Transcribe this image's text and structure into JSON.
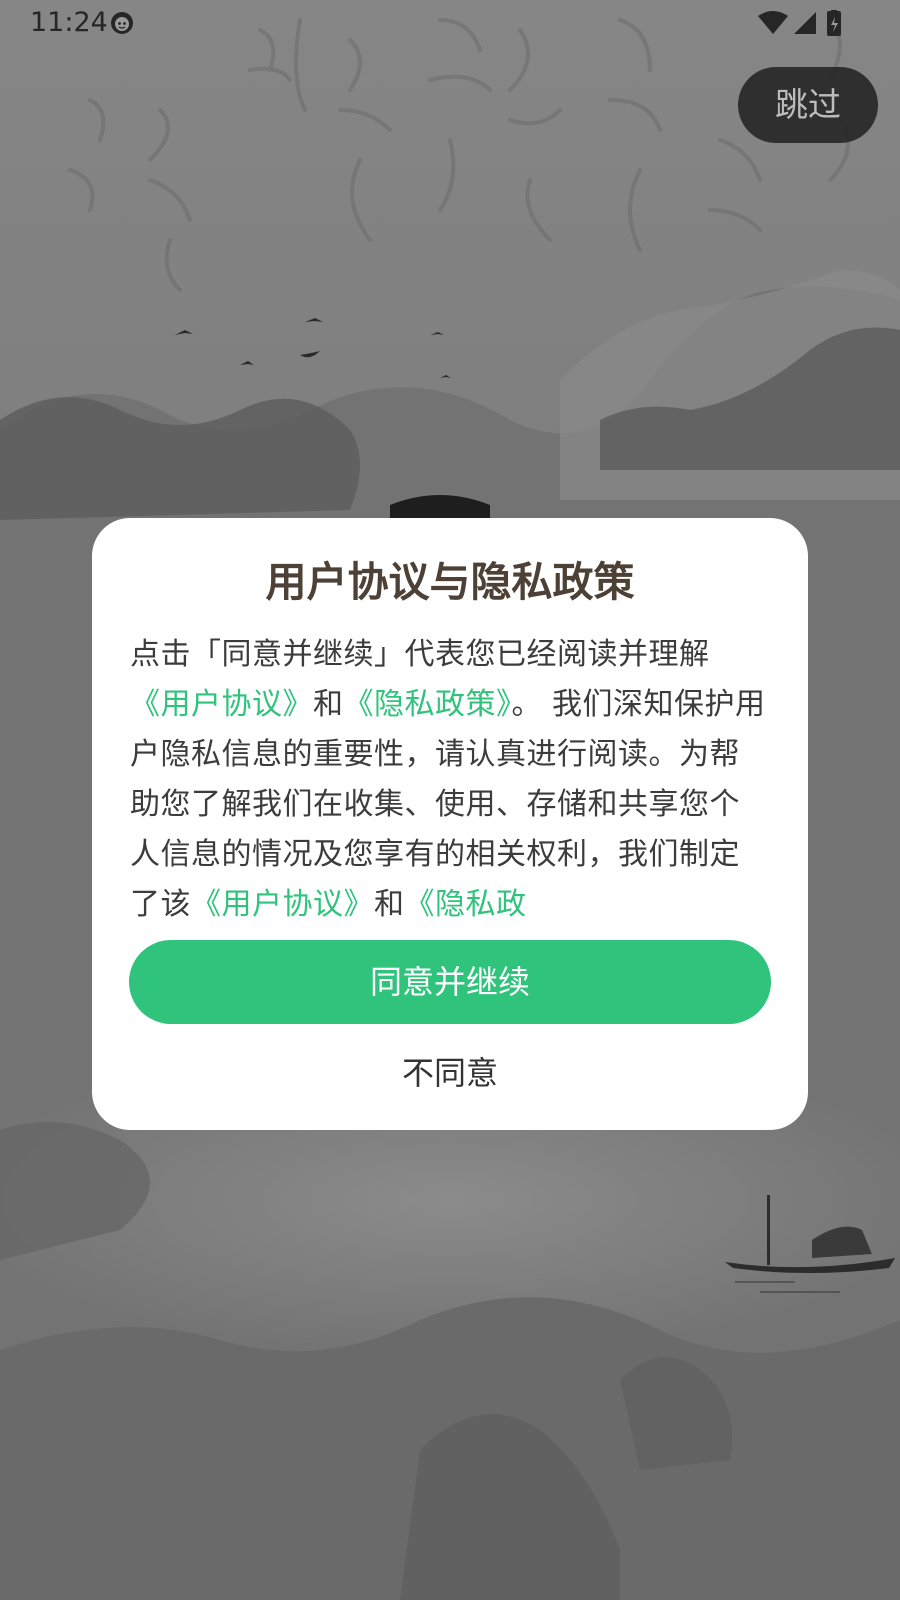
{
  "status_bar": {
    "time": "11:24",
    "app_icon": "cat-face-icon",
    "wifi_icon": "wifi-icon",
    "signal_icon": "cellular-signal-icon",
    "battery_icon": "battery-charging-icon"
  },
  "skip_button": {
    "label": "跳过"
  },
  "dialog": {
    "title": "用户协议与隐私政策",
    "body": {
      "intro": "点击「同意并继续」代表您已经阅读并理解",
      "link_user_agreement": "《用户协议》",
      "and_1": "和",
      "link_privacy_policy": "《隐私政策》",
      "middle": "。 我们深知保护用户隐私信息的重要性，请认真进行阅读。为帮助您了解我们在收集、使用、存储和共享您个人信息的情况及您享有的相关权利，我们制定了该",
      "link_user_agreement_2": "《用户协议》",
      "and_2": "和",
      "link_privacy_policy_2": "《隐私政"
    },
    "agree_label": "同意并继续",
    "disagree_label": "不同意"
  },
  "colors": {
    "accent_green": "#2fc37c",
    "title_brown": "#4d4035",
    "overlay_dark": "#7a7a7a",
    "skip_bg": "#232323"
  }
}
